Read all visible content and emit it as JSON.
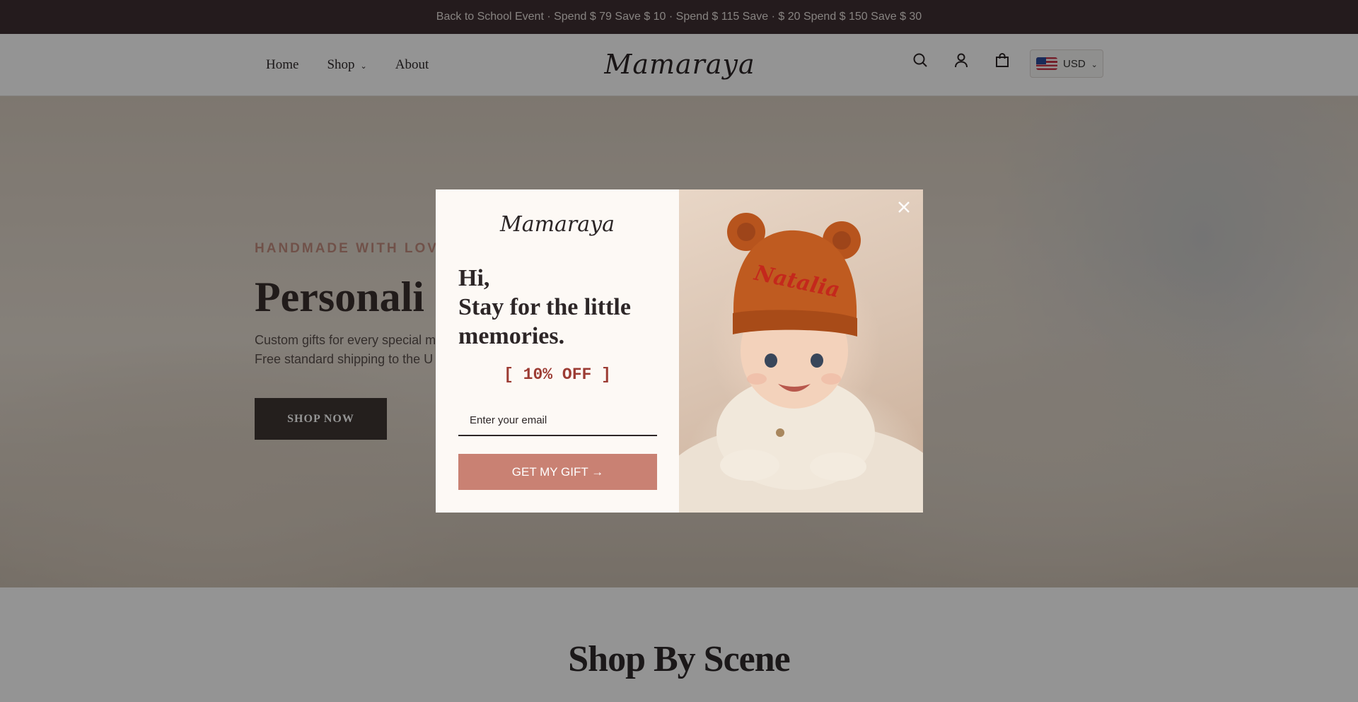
{
  "announcement": "Back to School Event · Spend $ 79 Save $ 10 · Spend $ 115 Save · $ 20 Spend $ 150 Save $ 30",
  "header": {
    "nav": [
      {
        "label": "Home"
      },
      {
        "label": "Shop",
        "icon": "chevron-down-icon"
      },
      {
        "label": "About"
      }
    ],
    "logo": "Mamaraya",
    "icons": [
      "search-icon",
      "account-icon",
      "cart-icon"
    ],
    "currency": {
      "code": "USD",
      "flag": "us-flag-icon"
    }
  },
  "hero": {
    "tagline": "HANDMADE WITH LOV",
    "title": "Personali",
    "subtitle_line1": "Custom gifts for every special m",
    "subtitle_line2": "Free standard shipping to the U",
    "cta": "SHOP NOW"
  },
  "section": {
    "title": "Shop By Scene"
  },
  "popup": {
    "logo": "Mamaraya",
    "heading_line1": "Hi,",
    "heading_line2": "Stay for the little",
    "heading_line3": "memories.",
    "offer": "[ 10% OFF ]",
    "email_placeholder": "Enter your email",
    "button": "GET MY GIFT →",
    "hat_name": "Natalia",
    "close_icon": "close-icon"
  },
  "colors": {
    "announcement_bg": "#3e2f33",
    "accent": "#c98173",
    "offer_text": "#9c3b33",
    "hero_button": "#3e3632"
  }
}
